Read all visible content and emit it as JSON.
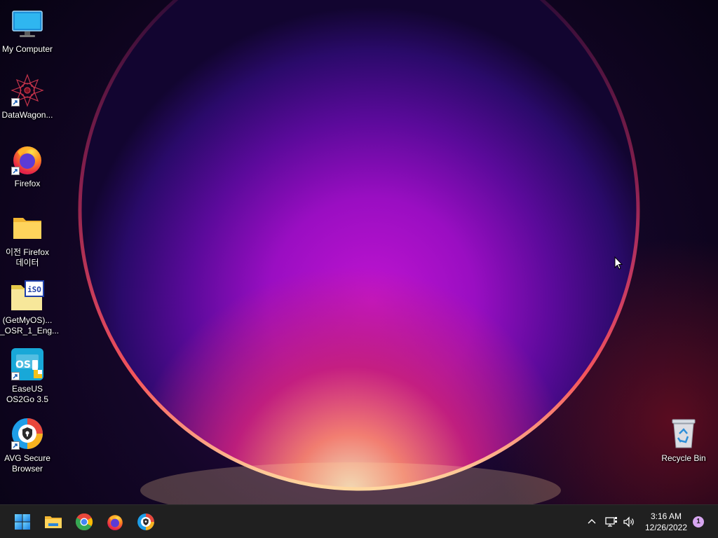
{
  "desktop": {
    "icons": [
      {
        "label": "My Computer",
        "icon": "monitor-icon",
        "shortcut": false
      },
      {
        "label": "DataWagon...",
        "icon": "mandala-icon",
        "shortcut": true
      },
      {
        "label": "Firefox",
        "icon": "firefox-icon",
        "shortcut": true
      },
      {
        "label": "이전 Firefox\n데이터",
        "icon": "folder-icon",
        "shortcut": false
      },
      {
        "label": "(GetMyOS)...\n_OSR_1_Eng...",
        "icon": "iso-file-icon",
        "shortcut": false
      },
      {
        "label": "EaseUS\nOS2Go 3.5",
        "icon": "easeus-icon",
        "shortcut": true
      },
      {
        "label": "AVG Secure\nBrowser",
        "icon": "avg-browser-icon",
        "shortcut": true
      }
    ],
    "recycle_bin": {
      "label": "Recycle Bin",
      "icon": "recycle-bin-icon"
    }
  },
  "taskbar": {
    "pinned": [
      {
        "name": "start",
        "icon": "windows-start-icon"
      },
      {
        "name": "file-explorer",
        "icon": "folder-icon"
      },
      {
        "name": "chrome",
        "icon": "chrome-icon"
      },
      {
        "name": "firefox",
        "icon": "firefox-icon"
      },
      {
        "name": "avg-browser",
        "icon": "avg-browser-icon"
      }
    ],
    "tray": {
      "time": "3:16 AM",
      "date": "12/26/2022",
      "notifications": "1"
    }
  },
  "colors": {
    "taskbar": "#202020",
    "wallpaper_magenta": "#b010c8",
    "wallpaper_rim": "#ff3b6b"
  }
}
